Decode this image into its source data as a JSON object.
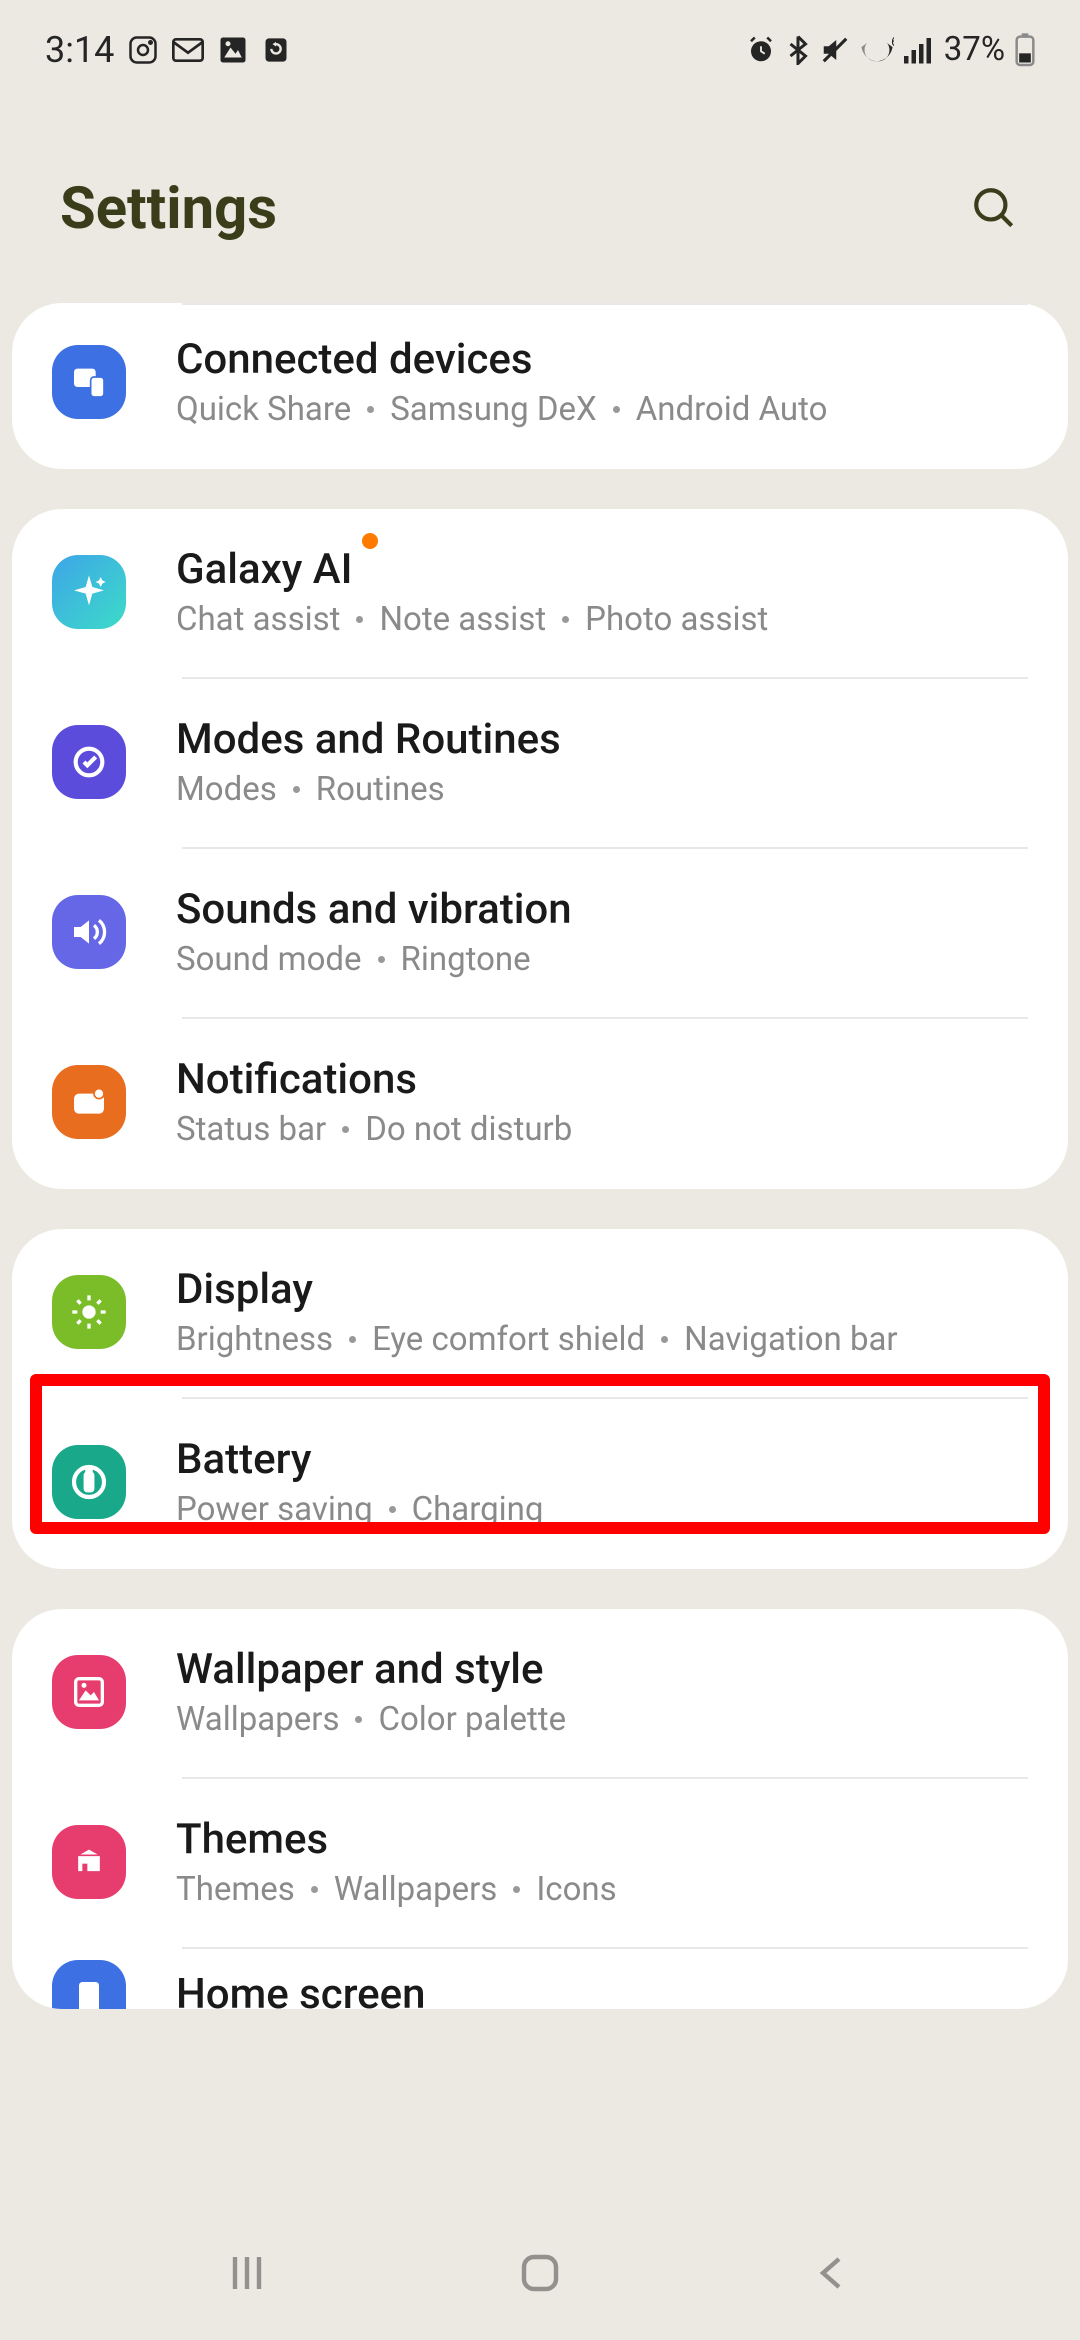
{
  "status": {
    "time": "3:14",
    "battery": "37%"
  },
  "header": {
    "title": "Settings"
  },
  "groups": [
    {
      "items": [
        {
          "id": "connected-devices",
          "title": "Connected devices",
          "subs": [
            "Quick Share",
            "Samsung DeX",
            "Android Auto"
          ],
          "icon_color": "#3d70e2",
          "highlighted": false,
          "partial_top": true
        }
      ]
    },
    {
      "items": [
        {
          "id": "galaxy-ai",
          "title": "Galaxy AI",
          "subs": [
            "Chat assist",
            "Note assist",
            "Photo assist"
          ],
          "icon_color": "#29b4e0",
          "new_badge": true
        },
        {
          "id": "modes-routines",
          "title": "Modes and Routines",
          "subs": [
            "Modes",
            "Routines"
          ],
          "icon_color": "#5b4cdb"
        },
        {
          "id": "sounds-vibration",
          "title": "Sounds and vibration",
          "subs": [
            "Sound mode",
            "Ringtone"
          ],
          "icon_color": "#6567e6"
        },
        {
          "id": "notifications",
          "title": "Notifications",
          "subs": [
            "Status bar",
            "Do not disturb"
          ],
          "icon_color": "#e96d1f"
        }
      ]
    },
    {
      "items": [
        {
          "id": "display",
          "title": "Display",
          "subs": [
            "Brightness",
            "Eye comfort shield",
            "Navigation bar"
          ],
          "icon_color": "#7bbd28",
          "highlighted": true
        },
        {
          "id": "battery",
          "title": "Battery",
          "subs": [
            "Power saving",
            "Charging"
          ],
          "icon_color": "#1aa88a"
        }
      ]
    },
    {
      "items": [
        {
          "id": "wallpaper-style",
          "title": "Wallpaper and style",
          "subs": [
            "Wallpapers",
            "Color palette"
          ],
          "icon_color": "#e73d6e"
        },
        {
          "id": "themes",
          "title": "Themes",
          "subs": [
            "Themes",
            "Wallpapers",
            "Icons"
          ],
          "icon_color": "#e73d6e"
        },
        {
          "id": "home-screen",
          "title": "Home screen",
          "subs": [],
          "icon_color": "#3d70e2",
          "cut_off": true
        }
      ]
    }
  ]
}
